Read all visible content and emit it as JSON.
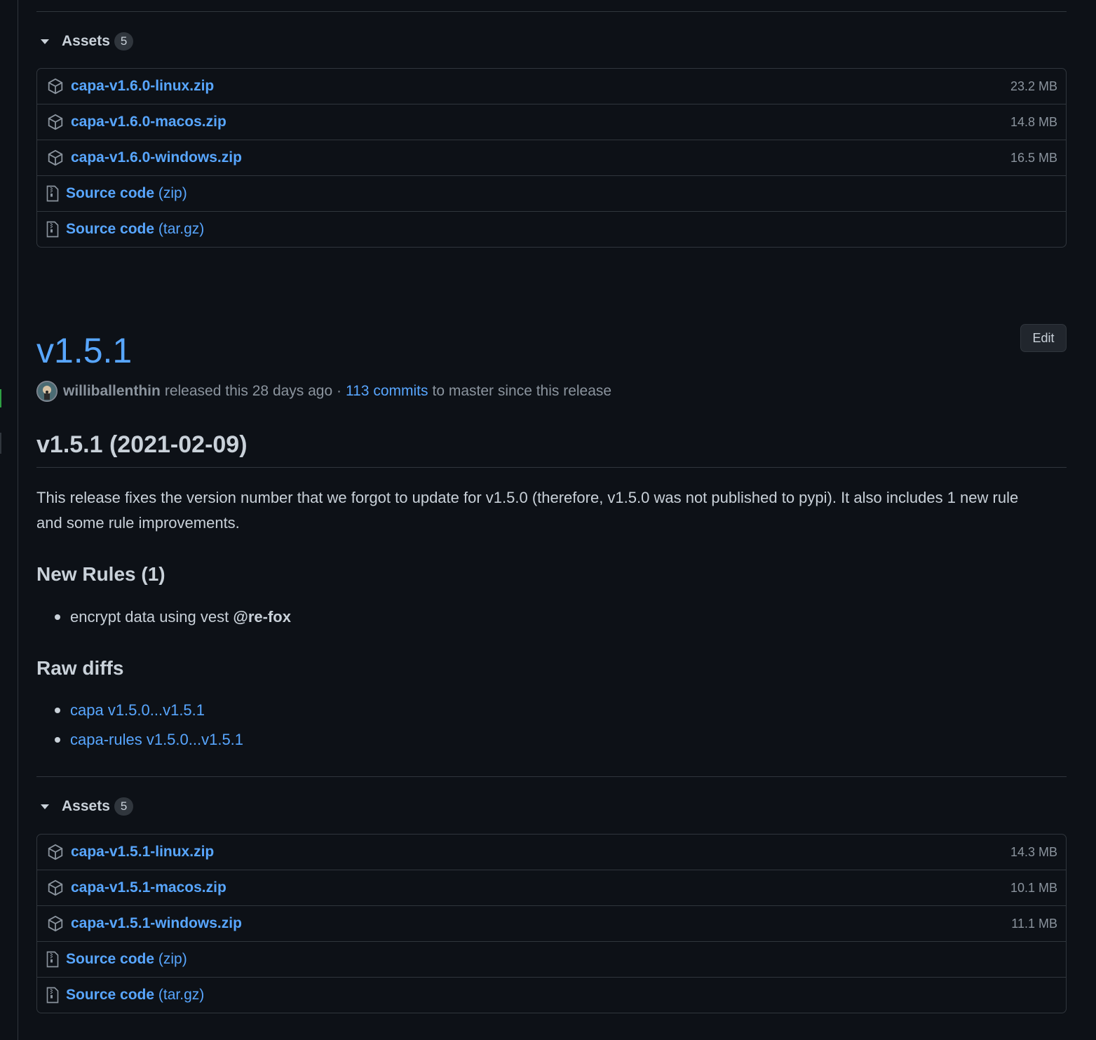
{
  "previous_release": {
    "assets_label": "Assets",
    "assets_count": "5",
    "assets": [
      {
        "name": "capa-v1.6.0-linux.zip",
        "size": "23.2 MB"
      },
      {
        "name": "capa-v1.6.0-macos.zip",
        "size": "14.8 MB"
      },
      {
        "name": "capa-v1.6.0-windows.zip",
        "size": "16.5 MB"
      }
    ],
    "source": [
      {
        "name": "Source code",
        "suffix": "(zip)"
      },
      {
        "name": "Source code",
        "suffix": "(tar.gz)"
      }
    ]
  },
  "release": {
    "title": "v1.5.1",
    "edit_label": "Edit",
    "author": "williballenthin",
    "released_text": "released this 28 days ago ·",
    "commits_link": "113 commits",
    "commits_suffix": "to master since this release",
    "heading": "v1.5.1 (2021-02-09)",
    "description": "This release fixes the version number that we forgot to update for v1.5.0 (therefore, v1.5.0 was not published to pypi). It also includes 1 new rule and some rule improvements.",
    "new_rules_heading": "New Rules (1)",
    "new_rules": [
      {
        "text": "encrypt data using vest",
        "mention": "@re-fox"
      }
    ],
    "raw_diffs_heading": "Raw diffs",
    "raw_diffs": [
      "capa v1.5.0...v1.5.1",
      "capa-rules v1.5.0...v1.5.1"
    ],
    "assets_label": "Assets",
    "assets_count": "5",
    "assets": [
      {
        "name": "capa-v1.5.1-linux.zip",
        "size": "14.3 MB"
      },
      {
        "name": "capa-v1.5.1-macos.zip",
        "size": "10.1 MB"
      },
      {
        "name": "capa-v1.5.1-windows.zip",
        "size": "11.1 MB"
      }
    ],
    "source": [
      {
        "name": "Source code",
        "suffix": "(zip)"
      },
      {
        "name": "Source code",
        "suffix": "(tar.gz)"
      }
    ]
  },
  "colors": {
    "background": "#0d1117",
    "link": "#58a6ff",
    "text": "#c9d1d9",
    "muted": "#8b949e",
    "border": "#30363d"
  },
  "icons": {
    "package": "package-icon",
    "zip": "file-zip-icon",
    "caret": "triangle-down-icon"
  }
}
